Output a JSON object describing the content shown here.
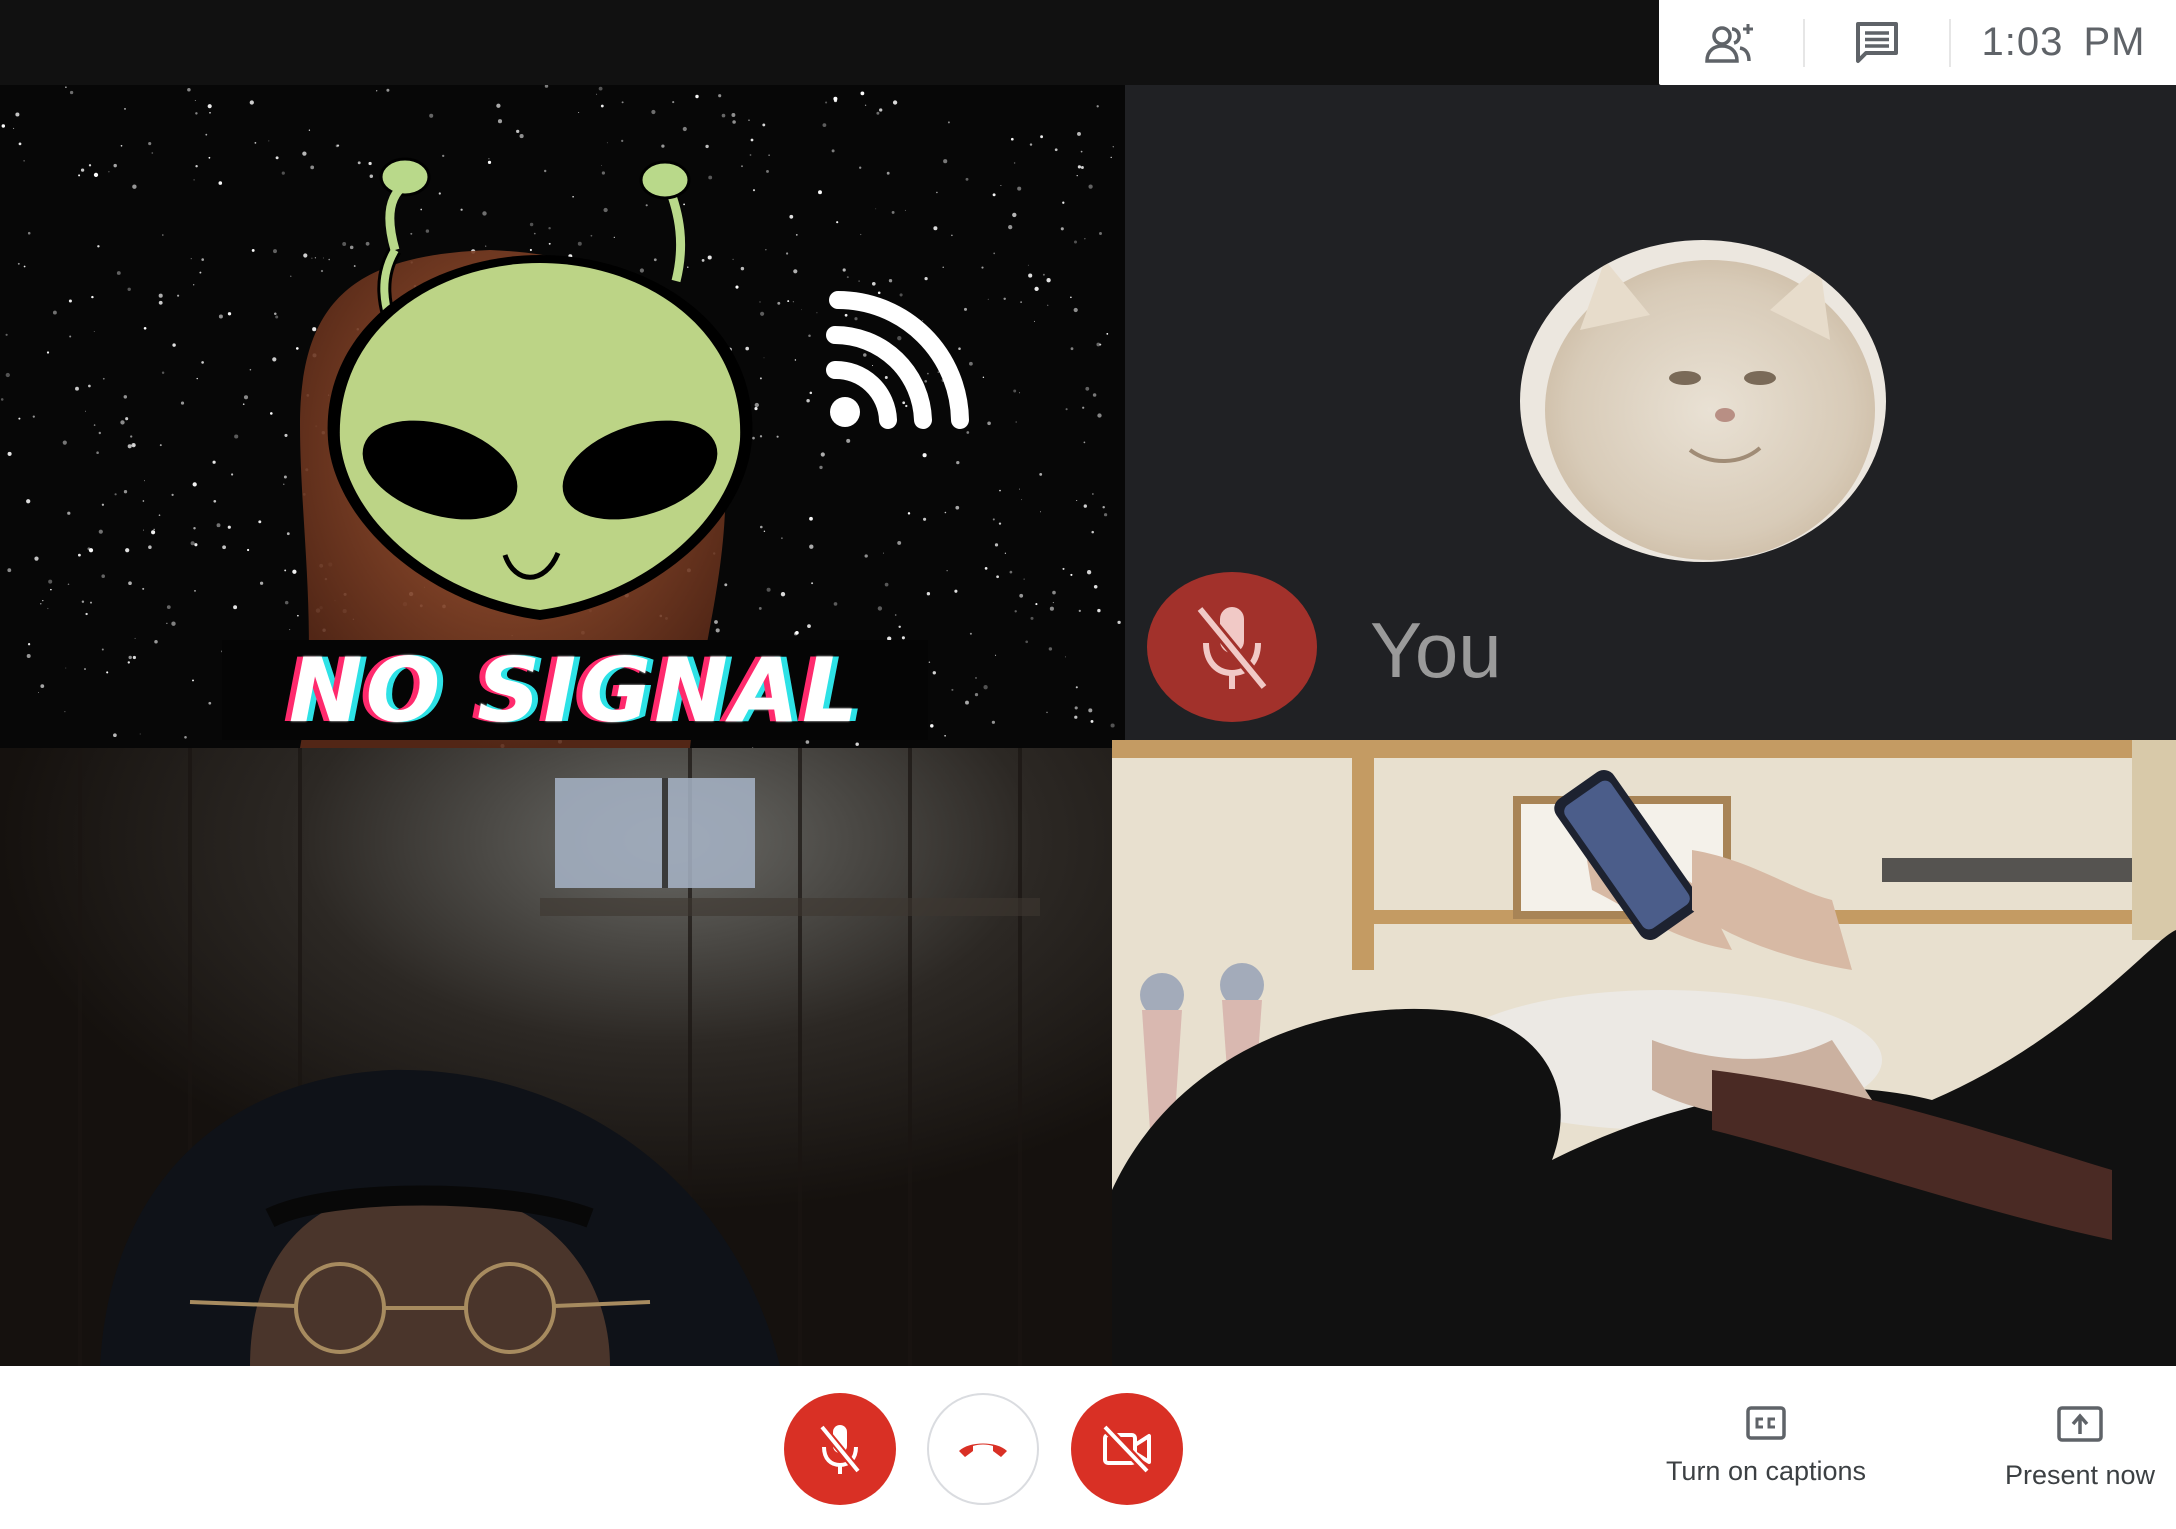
{
  "topbar": {
    "people_icon": "add-people-icon",
    "chat_icon": "chat-icon",
    "time": "1:03 PM"
  },
  "tiles": {
    "alien": {
      "overlay_text": "NO SIGNAL"
    },
    "self": {
      "name": "You",
      "mic_icon": "mic-off-icon"
    }
  },
  "controls": {
    "mic_icon": "mic-off-icon",
    "hangup_icon": "phone-hangup-icon",
    "camera_icon": "camera-off-icon",
    "captions_label": "Turn on captions",
    "captions_icon": "cc-icon",
    "present_label": "Present now",
    "present_icon": "present-screen-icon"
  },
  "colors": {
    "topbar": "#111111",
    "self_tile": "#202124",
    "red_button": "#d93025",
    "muted_badge": "#a2312b"
  }
}
